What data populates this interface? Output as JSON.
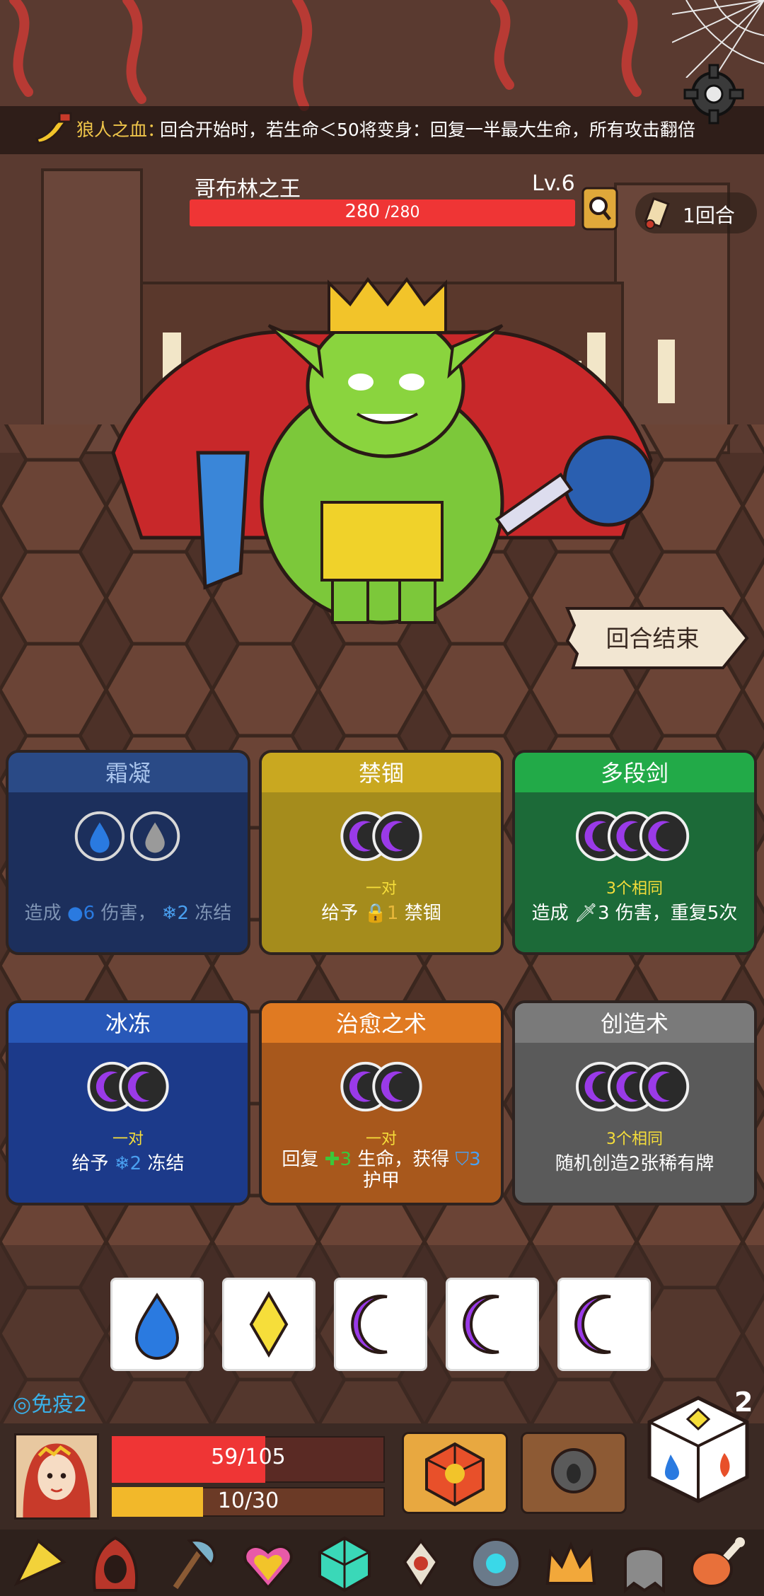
{
  "passive": {
    "icon": "horn-icon",
    "name": "狼人之血：",
    "description": "回合开始时，若生命＜50将变身：回复一半最大生命，所有攻击翻倍"
  },
  "enemy": {
    "name": "哥布林之王",
    "level": "Lv.6",
    "hp_current": "280",
    "hp_max": " /280",
    "hp_fraction": 1.0
  },
  "turn": {
    "label": "1回合"
  },
  "end_turn": {
    "label": "回合结束"
  },
  "cards": [
    {
      "title": "霜凝",
      "requirement": "",
      "effect_prefix": "造成",
      "effect_value1": "6",
      "effect_mid": "伤害，",
      "effect_value2": "2",
      "effect_suffix": "冻结",
      "color": "#1f3a7a",
      "header_color": "#2a4d8c"
    },
    {
      "title": "禁锢",
      "requirement": "一对",
      "effect_prefix": "给予",
      "effect_value1": "1",
      "effect_mid": "禁锢",
      "color": "#a38a1c",
      "header_color": "#c7a620"
    },
    {
      "title": "多段剑",
      "requirement": "3个相同",
      "effect_prefix": "造成",
      "effect_value1": "3",
      "effect_mid": "伤害，重复5次",
      "color": "#1c6b3a",
      "header_color": "#22a848"
    },
    {
      "title": "冰冻",
      "requirement": "一对",
      "effect_prefix": "给予",
      "effect_value1": "2",
      "effect_mid": "冻结",
      "color": "#1f3a8a",
      "header_color": "#2858b8"
    },
    {
      "title": "治愈之术",
      "requirement": "一对",
      "effect_prefix": "回复",
      "effect_value1": "3",
      "effect_mid": "生命，获得",
      "effect_value2": "3",
      "effect_line2": "护甲",
      "color": "#a85a1c",
      "header_color": "#e07a22"
    },
    {
      "title": "创造术",
      "requirement": "3个相同",
      "effect_prefix": "随机创造2张稀有牌",
      "color": "#5a5a5a",
      "header_color": "#7a7a7a"
    }
  ],
  "dice_tray": [
    "water-drop-icon",
    "diamond-icon",
    "moon-icon",
    "moon-icon",
    "moon-icon"
  ],
  "player": {
    "status": "免疫2",
    "hp": "59/105",
    "hp_fraction": 0.562,
    "energy": "10/30",
    "energy_fraction": 0.333,
    "rolls_left": "2"
  },
  "relics": [
    "cheese-wedge-icon",
    "hood-icon",
    "axe-icon",
    "heart-amulet-icon",
    "d20-gem-icon",
    "feathered-mask-icon",
    "eye-orb-icon",
    "crown-icon",
    "ghost-icon",
    "meat-leg-icon"
  ],
  "colors": {
    "hp": "#ef3535",
    "energy": "#f2b82a",
    "requirement": "#f6de3a",
    "water": "#2a7ae0",
    "frost": "#4aa0f0",
    "moon": "#9a3ae8",
    "heal": "#3ac83a"
  }
}
